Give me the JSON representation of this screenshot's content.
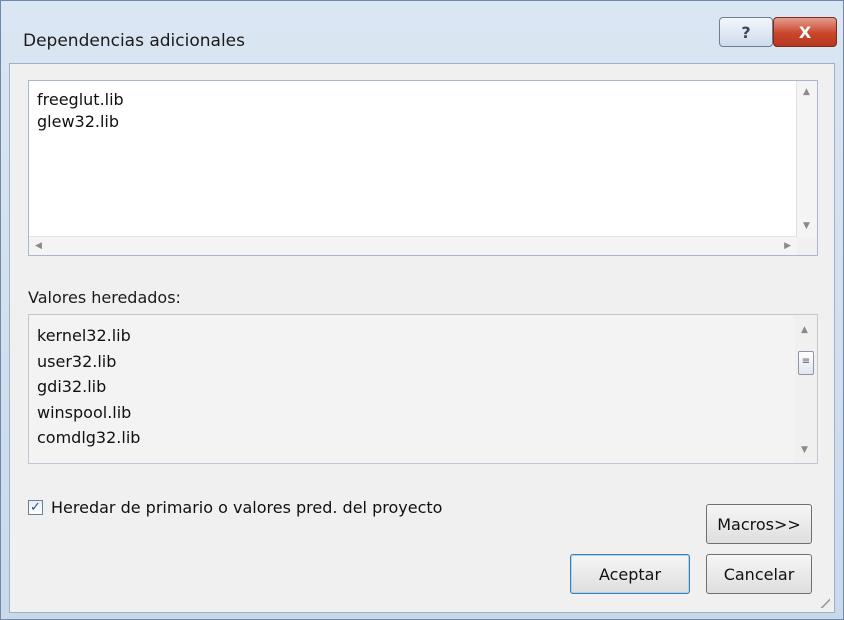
{
  "window": {
    "title": "Dependencias adicionales",
    "help_glyph": "?",
    "close_glyph": "X"
  },
  "editor": {
    "lines": [
      "freeglut.lib",
      "glew32.lib"
    ]
  },
  "inherited": {
    "label": "Valores heredados:",
    "lines": [
      "kernel32.lib",
      "user32.lib",
      "gdi32.lib",
      "winspool.lib",
      "comdlg32.lib"
    ]
  },
  "inherit_checkbox": {
    "label": "Heredar de primario o valores pred. del proyecto",
    "checked": true
  },
  "buttons": {
    "macros": "Macros>>",
    "ok": "Aceptar",
    "cancel": "Cancelar"
  },
  "colors": {
    "close_red": "#c8462c",
    "accent_blue": "#3c7fb1"
  },
  "icons": {
    "help": "question-mark-icon",
    "close": "close-icon",
    "checkbox": "checkmark-icon"
  }
}
